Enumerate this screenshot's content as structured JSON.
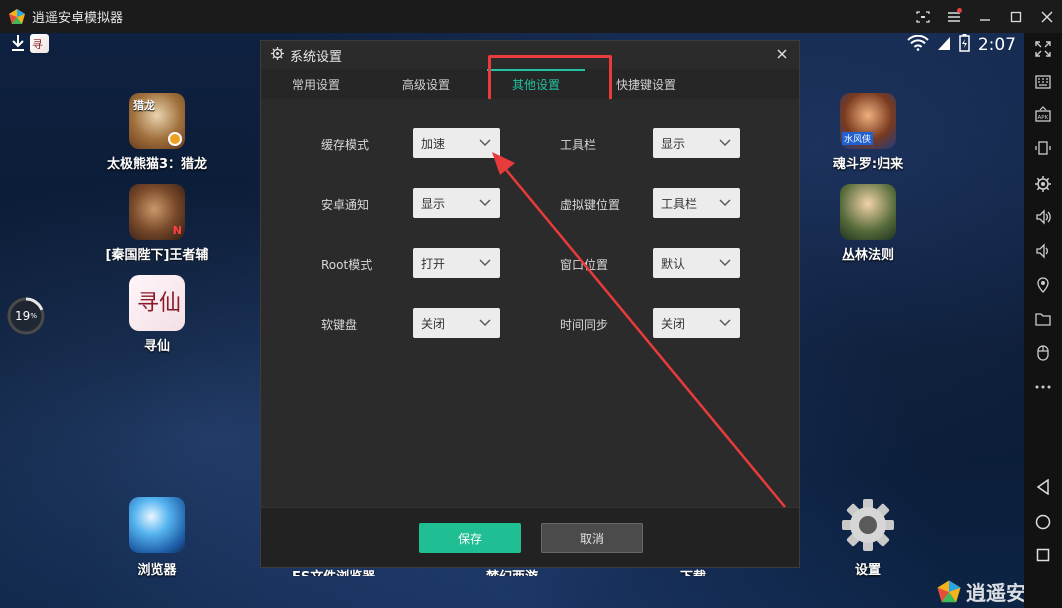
{
  "app": {
    "title": "逍遥安卓模拟器"
  },
  "status": {
    "time": "2:07"
  },
  "desktop": {
    "progress_percent": 19,
    "progress_label": "19",
    "progress_unit": "%",
    "apps_left": [
      {
        "label": "太极熊猫3：猎龙",
        "icon": "panda-game-icon",
        "badge": "猎龙"
      },
      {
        "label": "[秦国陛下]王者辅",
        "icon": "warrior-game-icon",
        "badge": "N"
      },
      {
        "label": "寻仙",
        "icon": "xunxian-game-icon",
        "badge": "寻仙"
      }
    ],
    "apps_right": [
      {
        "label": "魂斗罗:归来",
        "icon": "contra-game-icon",
        "badge": "水风侠"
      },
      {
        "label": "丛林法则",
        "icon": "jungle-game-icon"
      }
    ],
    "dock": [
      {
        "label": "浏览器",
        "icon": "browser-icon"
      },
      {
        "label": "ES文件浏览器",
        "icon": "es-file-icon"
      },
      {
        "label": "梦幻西游",
        "icon": "mhxy-icon"
      },
      {
        "label": "下载",
        "icon": "download-icon"
      },
      {
        "label": "设置",
        "icon": "settings-gear-icon"
      }
    ],
    "watermark": "逍遥安"
  },
  "dialog": {
    "title": "系统设置",
    "tabs": [
      {
        "label": "常用设置",
        "active": false
      },
      {
        "label": "高级设置",
        "active": false
      },
      {
        "label": "其他设置",
        "active": true
      },
      {
        "label": "快捷键设置",
        "active": false
      }
    ],
    "fields_left": [
      {
        "label": "缓存模式",
        "value": "加速"
      },
      {
        "label": "安卓通知",
        "value": "显示"
      },
      {
        "label": "Root模式",
        "value": "打开"
      },
      {
        "label": "软键盘",
        "value": "关闭"
      }
    ],
    "fields_right": [
      {
        "label": "工具栏",
        "value": "显示"
      },
      {
        "label": "虚拟键位置",
        "value": "工具栏"
      },
      {
        "label": "窗口位置",
        "value": "默认"
      },
      {
        "label": "时间同步",
        "value": "关闭"
      }
    ],
    "save_label": "保存",
    "cancel_label": "取消"
  },
  "colors": {
    "accent": "#22c3a0",
    "highlight": "#e83b3b",
    "save_button": "#1fbf93"
  },
  "sidebar": {
    "icons": [
      "fullscreen-icon",
      "keyboard-icon",
      "apk-install-icon",
      "rotate-icon",
      "settings-icon",
      "volume-up-icon",
      "volume-down-icon",
      "location-icon",
      "folder-icon",
      "mouse-icon",
      "more-icon",
      "back-icon",
      "home-icon",
      "recents-icon"
    ]
  }
}
